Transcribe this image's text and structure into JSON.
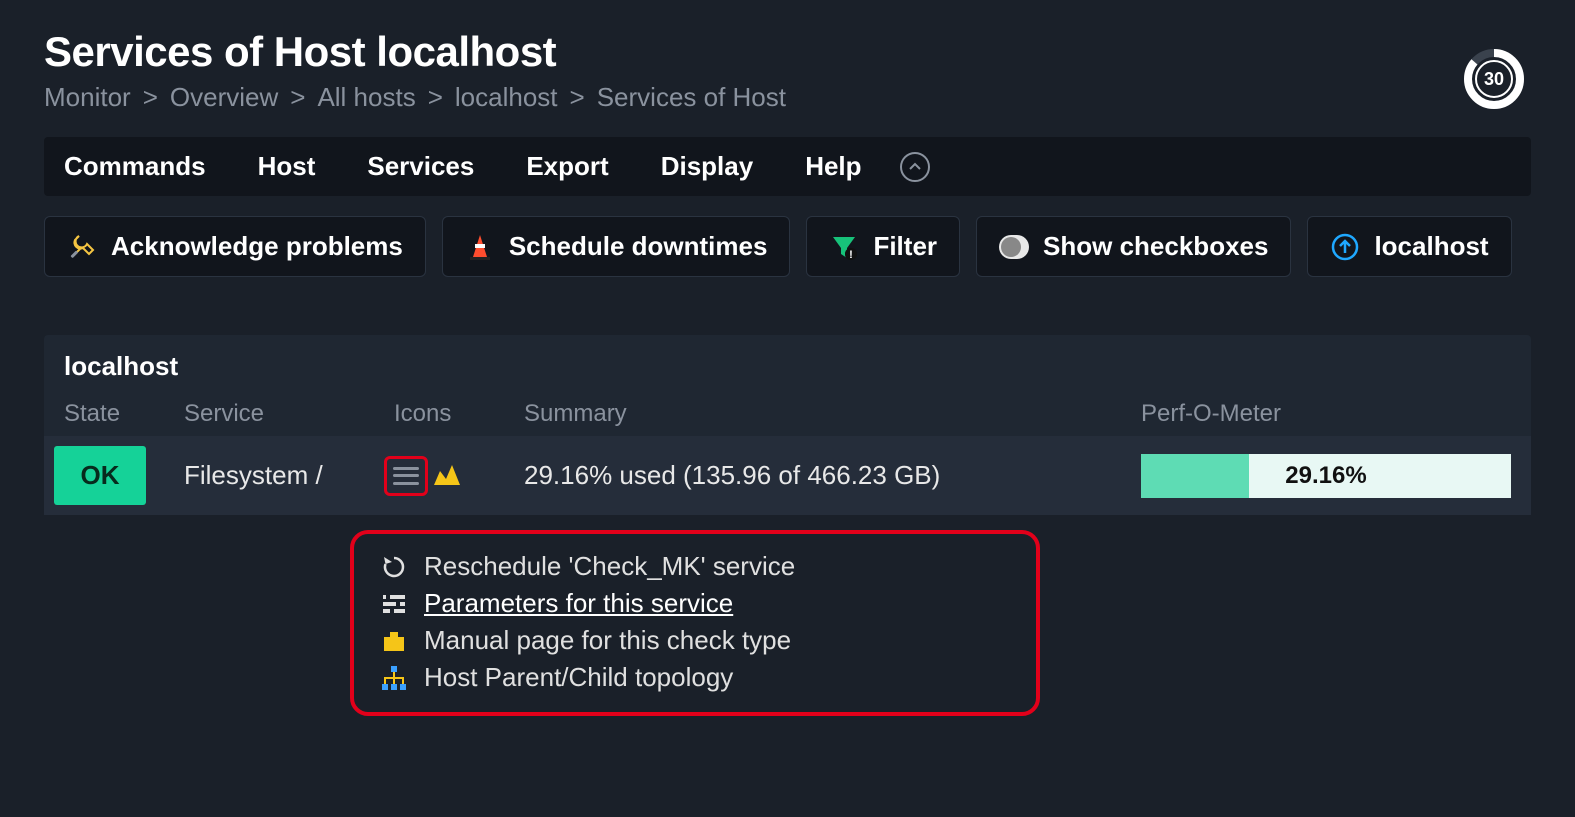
{
  "page": {
    "title": "Services of Host localhost",
    "refresh_seconds": "30"
  },
  "breadcrumb": {
    "items": [
      "Monitor",
      "Overview",
      "All hosts",
      "localhost",
      "Services of Host"
    ]
  },
  "menubar": {
    "items": [
      "Commands",
      "Host",
      "Services",
      "Export",
      "Display",
      "Help"
    ]
  },
  "toolbar": {
    "ack": "Acknowledge problems",
    "downtime": "Schedule downtimes",
    "filter": "Filter",
    "show_checkboxes": "Show checkboxes",
    "host_link": "localhost"
  },
  "panel": {
    "host": "localhost",
    "columns": {
      "state": "State",
      "service": "Service",
      "icons": "Icons",
      "summary": "Summary",
      "perf": "Perf-O-Meter"
    },
    "rows": [
      {
        "state": "OK",
        "service": "Filesystem /",
        "summary": "29.16% used (135.96 of 466.23 GB)",
        "perf_label": "29.16%",
        "perf_percent": 29.16
      }
    ]
  },
  "context_menu": {
    "items": [
      {
        "icon": "reload-icon",
        "label": "Reschedule 'Check_MK' service"
      },
      {
        "icon": "params-icon",
        "label": "Parameters for this service",
        "hover": true
      },
      {
        "icon": "manual-icon",
        "label": "Manual page for this check type"
      },
      {
        "icon": "topology-icon",
        "label": "Host Parent/Child topology"
      }
    ]
  }
}
